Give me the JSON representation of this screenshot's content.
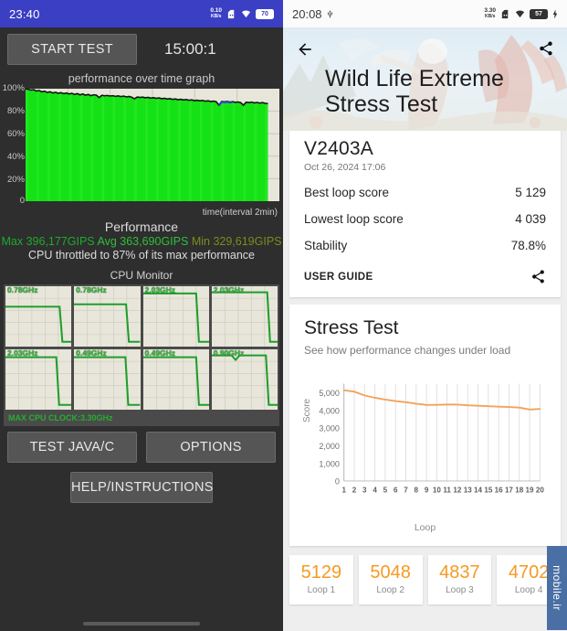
{
  "left_panel": {
    "status_bar": {
      "clock": "23:40",
      "net_speed_value": "0.10",
      "net_speed_unit": "KB/s",
      "sim_icon": "sim-card-icon",
      "wifi_icon": "wifi-icon",
      "battery_level": "70"
    },
    "start_button": "START TEST",
    "timer": "15:00:1",
    "graph_title": "performance over time graph",
    "y_ticks": [
      "100%",
      "80%",
      "60%",
      "40%",
      "20%",
      "0"
    ],
    "x_caption": "time(interval 2min)",
    "performance_heading": "Performance",
    "gips": {
      "max_label": "Max",
      "max_value": "396,177GIPS",
      "avg_label": "Avg",
      "avg_value": "363,690GIPS",
      "min_label": "Min",
      "min_value": "329,619GIPS",
      "max_color": "#1faa2b",
      "avg_color": "#2fbf3a",
      "min_color": "#7f8a1b"
    },
    "throttle_text": "CPU throttled to 87% of its max performance",
    "cpu_monitor_title": "CPU Monitor",
    "cpu_cores": [
      {
        "freq": "0.78GHz"
      },
      {
        "freq": "0.78GHz"
      },
      {
        "freq": "2.03GHz"
      },
      {
        "freq": "2.03GHz"
      },
      {
        "freq": "2.03GHz"
      },
      {
        "freq": "0.49GHz"
      },
      {
        "freq": "0.49GHz"
      },
      {
        "freq": "0.90GHz"
      }
    ],
    "max_cpu_clock": "MAX CPU CLOCK:3.30GHz",
    "buttons": {
      "test_java_c": "TEST JAVA/C",
      "options": "OPTIONS",
      "help": "HELP/INSTRUCTIONS"
    }
  },
  "right_panel": {
    "status_bar": {
      "clock": "20:08",
      "usb_icon": "usb-icon",
      "net_speed_value": "3.30",
      "net_speed_unit": "KB/s",
      "sim_icon": "sim-card-icon",
      "wifi_icon": "wifi-icon",
      "battery_level": "57",
      "charging_icon": "charging-bolt-icon"
    },
    "hero": {
      "back_icon": "back-arrow-icon",
      "share_icon": "share-icon",
      "title_line1": "Wild Life Extreme",
      "title_line2": "Stress Test"
    },
    "result_card": {
      "device": "V2403A",
      "date": "Oct 26, 2024 17:06",
      "rows": [
        {
          "label": "Best loop score",
          "value": "5 129"
        },
        {
          "label": "Lowest loop score",
          "value": "4 039"
        },
        {
          "label": "Stability",
          "value": "78.8%"
        }
      ],
      "user_guide": "USER GUIDE",
      "share_icon": "share-icon"
    },
    "stress_test": {
      "title": "Stress Test",
      "subtitle": "See how performance changes under load"
    },
    "loop_cards": [
      {
        "score": "5129",
        "label": "Loop 1"
      },
      {
        "score": "5048",
        "label": "Loop 2"
      },
      {
        "score": "4837",
        "label": "Loop 3"
      },
      {
        "score": "4702",
        "label": "Loop 4"
      }
    ],
    "watermark": "mobile.ir"
  },
  "chart_data": [
    {
      "type": "area",
      "title": "performance over time graph",
      "xlabel": "time(interval 2min)",
      "ylabel": "",
      "ylim": [
        0,
        100
      ],
      "yticks": [
        0,
        20,
        40,
        60,
        80,
        100
      ],
      "ytick_labels": [
        "0",
        "20%",
        "40%",
        "60%",
        "80%",
        "100%"
      ],
      "grid": true,
      "series_color": "#16e616",
      "line_color": "#111111",
      "x": [
        0,
        1,
        2,
        3,
        4,
        5,
        6,
        7,
        8,
        9,
        10,
        11,
        12,
        13,
        14,
        15,
        16,
        17,
        18,
        19,
        20,
        21,
        22,
        23,
        24,
        25,
        26,
        27,
        28,
        29,
        30,
        31,
        32,
        33,
        34,
        35,
        36,
        37,
        38,
        39,
        40,
        41,
        42,
        43,
        44,
        45,
        46,
        47,
        48,
        49,
        50,
        51,
        52,
        53,
        54,
        55,
        56,
        57,
        58,
        59,
        60,
        61,
        62,
        63,
        64,
        65,
        66,
        67,
        68,
        69,
        70,
        71,
        72,
        73,
        74,
        75,
        76,
        77,
        78,
        79,
        80,
        81,
        82,
        83,
        84,
        85,
        86,
        87,
        88,
        89
      ],
      "values": [
        100,
        99.4,
        98.8,
        99.1,
        97.9,
        98.4,
        97.2,
        97.8,
        96.6,
        97.3,
        96.2,
        96.8,
        95.9,
        96.5,
        95.6,
        96.2,
        95.3,
        95.9,
        94.9,
        95.6,
        94.5,
        95.3,
        94.2,
        94.9,
        93.8,
        94.6,
        94.3,
        92.1,
        94.1,
        93.7,
        94.0,
        93.5,
        93.8,
        93.2,
        93.6,
        93.0,
        93.4,
        92.7,
        93.1,
        92.4,
        91.0,
        92.6,
        92.2,
        92.5,
        91.9,
        92.3,
        91.6,
        92.0,
        91.4,
        91.8,
        91.1,
        91.5,
        90.8,
        91.2,
        90.5,
        90.9,
        90.2,
        90.6,
        90.0,
        90.4,
        89.7,
        90.1,
        89.4,
        89.8,
        89.2,
        89.6,
        88.9,
        89.3,
        88.6,
        89.0,
        88.4,
        85.4,
        88.6,
        88.3,
        88.7,
        88.1,
        88.5,
        87.9,
        88.2,
        87.6,
        85.3,
        88.0,
        87.7,
        88.1,
        87.4,
        87.8,
        87.2,
        87.6,
        87.0,
        86.8
      ]
    },
    {
      "type": "line",
      "title": "Stress Test",
      "xlabel": "Loop",
      "ylabel": "Score",
      "ylim": [
        0,
        5500
      ],
      "yticks": [
        0,
        1000,
        2000,
        3000,
        4000,
        5000
      ],
      "ytick_labels": [
        "0",
        "1,000",
        "2,000",
        "3,000",
        "4,000",
        "5,000"
      ],
      "grid": true,
      "line_color": "#f3a35c",
      "categories": [
        1,
        2,
        3,
        4,
        5,
        6,
        7,
        8,
        9,
        10,
        11,
        12,
        13,
        14,
        15,
        16,
        17,
        18,
        19,
        20
      ],
      "values": [
        5129,
        5048,
        4837,
        4702,
        4600,
        4520,
        4455,
        4370,
        4300,
        4305,
        4320,
        4318,
        4280,
        4250,
        4225,
        4200,
        4180,
        4150,
        4039,
        4070
      ]
    }
  ]
}
